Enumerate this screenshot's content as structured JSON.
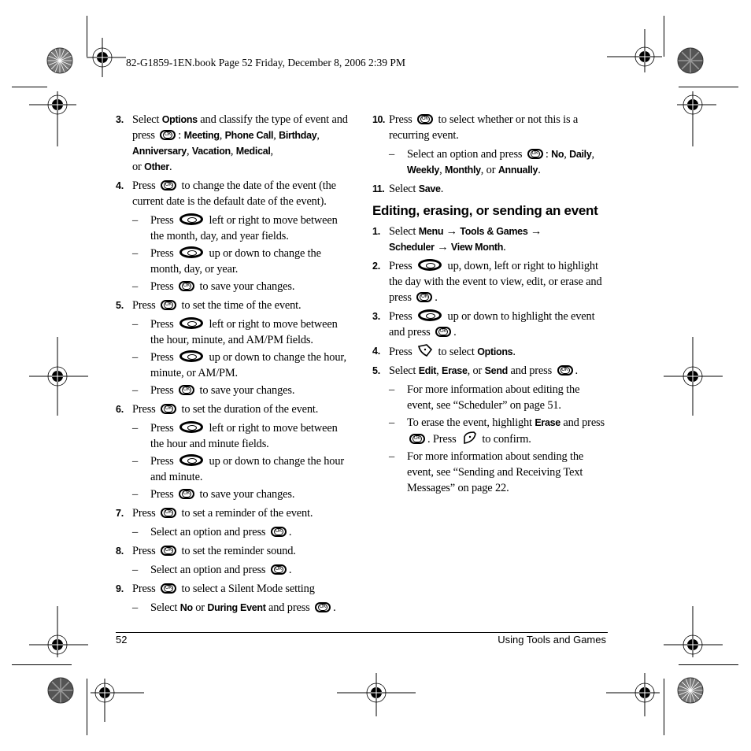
{
  "header": {
    "book_info": "82-G1859-1EN.book  Page 52  Friday, December 8, 2006  2:39 PM"
  },
  "icons": {
    "ok": "ok-key-icon",
    "nav": "navigation-key-icon",
    "left_soft": "left-softkey-icon",
    "right_soft": "right-softkey-icon"
  },
  "left_column": {
    "s3": {
      "num": "3.",
      "a": "Select ",
      "b1": "Options",
      "c": " and classify the type of event and press ",
      "d": ": ",
      "o1": "Meeting",
      "o2": "Phone Call",
      "o3": "Birthday",
      "o4": "Anniversary",
      "o5": "Vacation",
      "o6": "Medical",
      "or": "or ",
      "o7": "Other",
      "sep": ", ",
      "end": "."
    },
    "s4": {
      "num": "4.",
      "a": "Press ",
      "b": " to change the date of the event (the current date is the default date of the event).",
      "sub1a": "Press ",
      "sub1b": " left or right to move between the month, day, and year fields.",
      "sub2a": "Press ",
      "sub2b": " up or down to change the month, day, or year.",
      "sub3a": "Press ",
      "sub3b": " to save your changes."
    },
    "s5": {
      "num": "5.",
      "a": "Press ",
      "b": " to set the time of the event.",
      "sub1a": "Press ",
      "sub1b": " left or right to move between the hour, minute, and AM/PM fields.",
      "sub2a": "Press ",
      "sub2b": " up or down to change the hour, minute, or AM/PM.",
      "sub3a": "Press ",
      "sub3b": " to save your changes."
    },
    "s6": {
      "num": "6.",
      "a": "Press ",
      "b": " to set the duration of the event.",
      "sub1a": "Press ",
      "sub1b": " left or right to move between the hour and minute fields.",
      "sub2a": "Press ",
      "sub2b": " up or down to change the hour and minute.",
      "sub3a": "Press ",
      "sub3b": " to save your changes."
    },
    "s7": {
      "num": "7.",
      "a": "Press ",
      "b": " to set a reminder of the event.",
      "sub1a": "Select an option and press ",
      "sub1b": "."
    },
    "s8": {
      "num": "8.",
      "a": "Press ",
      "b": " to set the reminder sound.",
      "sub1a": "Select an option and press ",
      "sub1b": "."
    },
    "s9": {
      "num": "9.",
      "a": "Press ",
      "b": " to select a Silent Mode setting",
      "sub1a": "Select ",
      "sub1b": "No",
      "sub1c": " or ",
      "sub1d": "During Event",
      "sub1e": " and press ",
      "sub1f": "."
    }
  },
  "right_column": {
    "s10": {
      "num": "10.",
      "a": "Press ",
      "b": " to select whether or not this is a recurring event.",
      "sub1a": "Select an option and press ",
      "sub1b": ": ",
      "o1": "No",
      "o2": "Daily",
      "o3": "Weekly",
      "o4": "Monthly",
      "or": ", or ",
      "o5": "Annually",
      "sep": ", ",
      "end": "."
    },
    "s11": {
      "num": "11.",
      "a": "Select ",
      "b": "Save",
      "c": "."
    },
    "heading": "Editing, erasing, or sending an event",
    "e1": {
      "num": "1.",
      "a": "Select ",
      "m1": "Menu",
      "arrow": " → ",
      "m2": "Tools & Games",
      "m3": "Scheduler",
      "m4": "View Month",
      "end": "."
    },
    "e2": {
      "num": "2.",
      "a": "Press ",
      "b": " up, down, left or right to highlight the day with the event to view, edit, or erase and press ",
      "c": "."
    },
    "e3": {
      "num": "3.",
      "a": "Press ",
      "b": " up or down to highlight the event and press ",
      "c": "."
    },
    "e4": {
      "num": "4.",
      "a": "Press ",
      "b": " to select ",
      "c": "Options",
      "d": "."
    },
    "e5": {
      "num": "5.",
      "a": "Select ",
      "o1": "Edit",
      "sep": ", ",
      "o2": "Erase",
      "or": ", or ",
      "o3": "Send",
      "b": " and press ",
      "c": ".",
      "sub1": "For more information about editing the event, see “Scheduler” on page 51.",
      "sub2a": "To erase the event, highlight ",
      "sub2b": "Erase",
      "sub2c": " and press ",
      "sub2d": ". Press ",
      "sub2e": " to confirm.",
      "sub3": "For more information about sending the event, see “Sending and Receiving Text Messages” on page 22."
    }
  },
  "footer": {
    "page_number": "52",
    "section_title": "Using Tools and Games"
  },
  "dash": "–"
}
